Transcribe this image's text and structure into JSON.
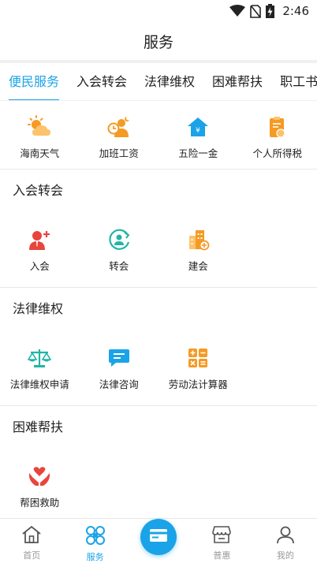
{
  "status_bar": {
    "time": "2:46",
    "icons": [
      "wifi-icon",
      "no-sim-icon",
      "battery-charging-icon"
    ]
  },
  "header": {
    "title": "服务"
  },
  "tabs": [
    {
      "label": "便民服务",
      "active": true
    },
    {
      "label": "入会转会",
      "active": false
    },
    {
      "label": "法律维权",
      "active": false
    },
    {
      "label": "困难帮扶",
      "active": false
    },
    {
      "label": "职工书屋",
      "active": false
    }
  ],
  "convenience": [
    {
      "label": "海南天气",
      "icon": "weather-icon"
    },
    {
      "label": "加班工资",
      "icon": "overtime-pay-icon"
    },
    {
      "label": "五险一金",
      "icon": "insurance-house-icon"
    },
    {
      "label": "个人所得税",
      "icon": "income-tax-icon"
    }
  ],
  "sections": [
    {
      "title": "入会转会",
      "items": [
        {
          "label": "入会",
          "icon": "join-union-icon"
        },
        {
          "label": "转会",
          "icon": "transfer-union-icon"
        },
        {
          "label": "建会",
          "icon": "build-union-icon"
        }
      ]
    },
    {
      "title": "法律维权",
      "items": [
        {
          "label": "法律维权申请",
          "icon": "scales-icon"
        },
        {
          "label": "法律咨询",
          "icon": "chat-icon"
        },
        {
          "label": "劳动法计算器",
          "icon": "calculator-icon"
        }
      ]
    },
    {
      "title": "困难帮扶",
      "items": [
        {
          "label": "帮困救助",
          "icon": "hands-heart-icon"
        }
      ]
    }
  ],
  "bottom_nav": [
    {
      "label": "首页",
      "icon": "home-icon",
      "active": false
    },
    {
      "label": "服务",
      "icon": "services-icon",
      "active": true
    },
    {
      "label": "",
      "icon": "card-icon",
      "active": false
    },
    {
      "label": "普惠",
      "icon": "shop-icon",
      "active": false
    },
    {
      "label": "我的",
      "icon": "user-icon",
      "active": false
    }
  ],
  "colors": {
    "accent": "#1aa3e8",
    "orange": "#f59a23",
    "red": "#e8453c",
    "teal": "#21b5a5"
  }
}
